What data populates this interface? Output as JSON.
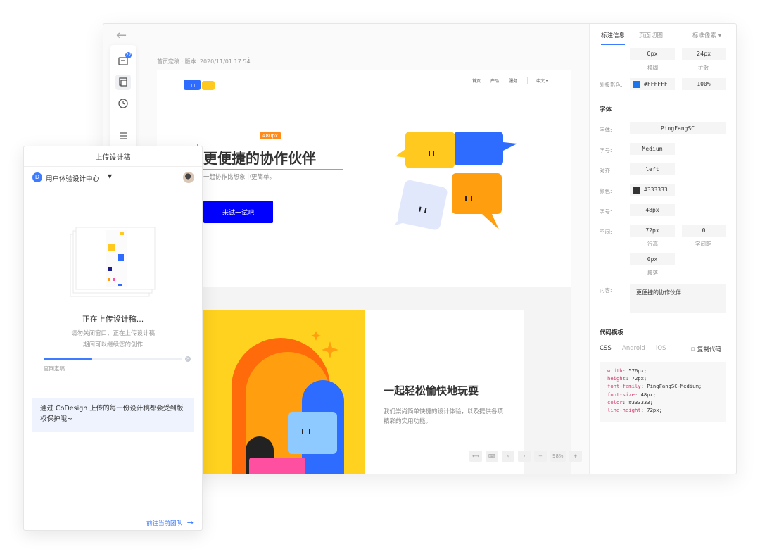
{
  "editor": {
    "breadcrumb": "首页定稿 · 版本: 2020/11/01 17:54",
    "toolbar_badge": "22"
  },
  "artboard": {
    "nav": [
      "首页",
      "产品",
      "服务"
    ],
    "lang": "中文 ▾",
    "dim_badge": "480px",
    "hero_title": "更便捷的协作伙伴",
    "hero_subtitle": "一起协作比想象中更简单。",
    "hero_cta": "来试一试吧",
    "card_title": "一起轻松愉快地玩耍",
    "card_desc": "我们崇尚简单快捷的设计体验，以及提供各项精彩的实用功能。",
    "zoom": "98%",
    "zoom_minus": "−",
    "zoom_plus": "+"
  },
  "inspector": {
    "tabs": [
      "标注信息",
      "页面切图",
      "标准像素 ▾"
    ],
    "shadow_blur": "0px",
    "shadow_blur_label": "模糊",
    "shadow_spread": "24px",
    "shadow_spread_label": "扩散",
    "outer_shadow_label": "外投影色:",
    "outer_shadow_color": "#FFFFFF",
    "outer_shadow_swatch": "#1a73e8",
    "outer_shadow_opacity": "100%",
    "font_section": "字体",
    "font_label": "字体:",
    "font_value": "PingFangSC",
    "weight_label": "字号:",
    "weight_value": "Medium",
    "align_label": "对齐:",
    "align_value": "left",
    "color_label": "颜色:",
    "color_value": "#333333",
    "color_swatch": "#333333",
    "size_label": "字号:",
    "size_value": "48px",
    "spacing_label": "空间:",
    "line_height_value": "72px",
    "line_height_label": "行高",
    "letter_spacing_value": "0",
    "letter_spacing_label": "字间距",
    "paragraph_value": "0px",
    "paragraph_label": "段落",
    "content_label": "内容:",
    "content_value": "更便捷的协作伙伴",
    "code_section": "代码模板",
    "code_tabs": [
      "CSS",
      "Android",
      "iOS"
    ],
    "copy_code": "复制代码",
    "code_lines": [
      {
        "prop": "width",
        "val": " 576px;"
      },
      {
        "prop": "height",
        "val": " 72px;"
      },
      {
        "prop": "font-family",
        "val": " PingFangSC-Medium;"
      },
      {
        "prop": "font-size",
        "val": " 48px;"
      },
      {
        "prop": "color",
        "val": " #333333;"
      },
      {
        "prop": "line-height",
        "val": " 72px;"
      }
    ]
  },
  "upload": {
    "title": "上传设计稿",
    "team_initial": "D",
    "team_name": "用户体验设计中心",
    "status": "正在上传设计稿...",
    "hint_line1": "请勿关闭窗口，正在上传设计稿",
    "hint_line2": "期间可以继续您的创作",
    "progress": 0.35,
    "file_name": "官网定稿",
    "notice": "通过 CoDesign 上传的每一份设计稿都会受到版权保护哦~",
    "goto_team": "前往当前团队"
  },
  "colors": {
    "accent": "#3d7bff",
    "cta_blue": "#0000ff",
    "selection_orange": "#ff8c1a",
    "card_yellow": "#ffd21f"
  }
}
